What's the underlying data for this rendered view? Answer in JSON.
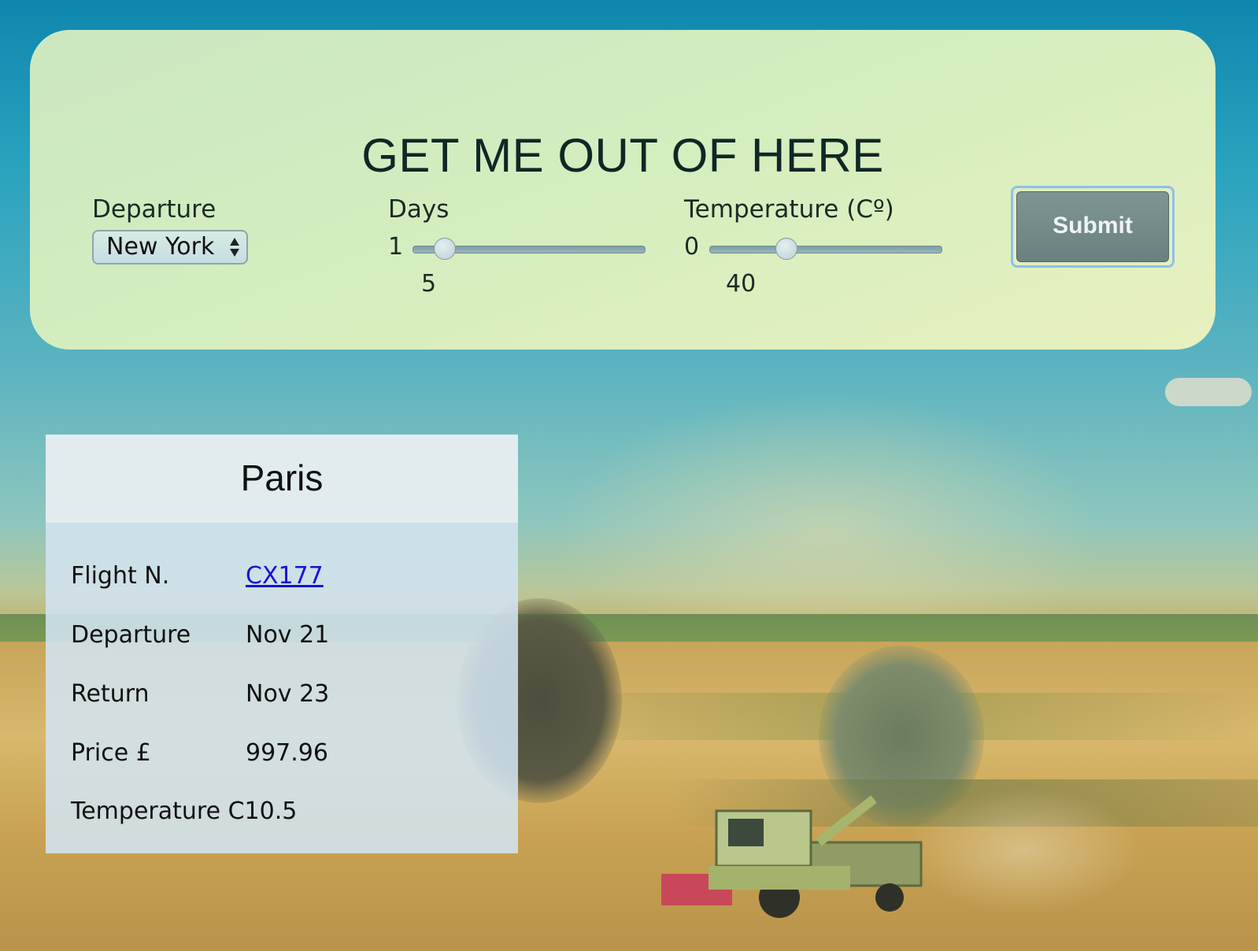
{
  "header": {
    "title": "GET ME OUT OF HERE"
  },
  "departure": {
    "label": "Departure",
    "selected": "New York"
  },
  "days": {
    "label": "Days",
    "min_label": "1",
    "value_label": "5",
    "min": 1,
    "max": 30,
    "value": 5
  },
  "temperature": {
    "label": "Temperature (Cº)",
    "min_label": "0",
    "value_label": "40",
    "min": 0,
    "max": 120,
    "value": 40
  },
  "submit": {
    "label": "Submit"
  },
  "result": {
    "city": "Paris",
    "rows": [
      {
        "label": "Flight N.",
        "value": "CX177"
      },
      {
        "label": "Departure",
        "value": "Nov 21"
      },
      {
        "label": "Return",
        "value": "Nov 23"
      },
      {
        "label": "Price £",
        "value": "997.96"
      }
    ],
    "temperature_line": "Temperature C10.5"
  }
}
